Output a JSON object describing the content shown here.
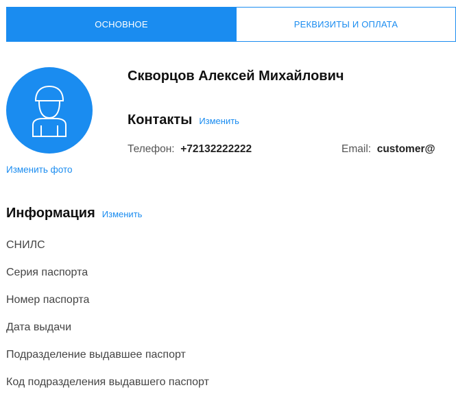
{
  "tabs": [
    {
      "label": "ОСНОВНОЕ",
      "active": true
    },
    {
      "label": "РЕКВИЗИТЫ И ОПЛАТА",
      "active": false
    }
  ],
  "profile": {
    "avatar_icon": "user-icon",
    "change_photo": "Изменить фото",
    "full_name": "Скворцов Алексей Михайлович"
  },
  "contacts": {
    "title": "Контакты",
    "edit": "Изменить",
    "phone_label": "Телефон:",
    "phone_value": "+72132222222",
    "email_label": "Email:",
    "email_value": "customer@"
  },
  "information": {
    "title": "Информация",
    "edit": "Изменить",
    "fields": [
      "СНИЛС",
      "Серия паспорта",
      "Номер паспорта",
      "Дата выдачи",
      "Подразделение выдавшее паспорт",
      "Код подразделения выдавшего паспорт"
    ]
  },
  "colors": {
    "accent": "#1a8cf0",
    "text": "#222222"
  }
}
